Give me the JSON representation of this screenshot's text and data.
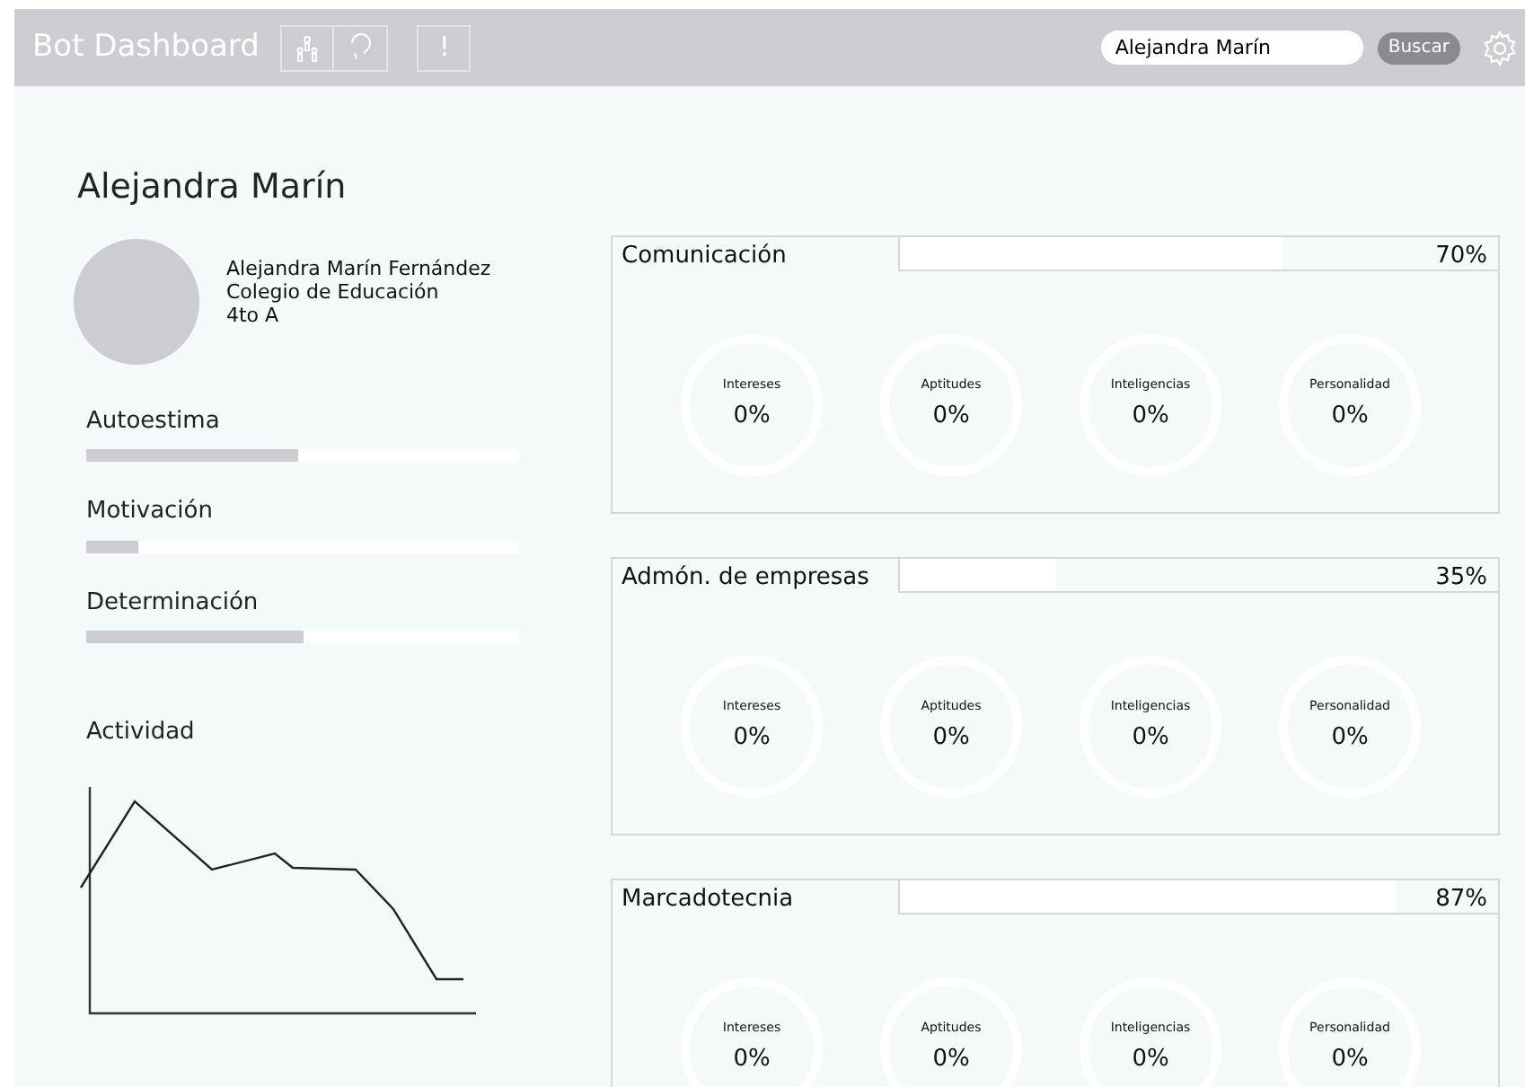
{
  "header": {
    "title": "Bot Dashboard",
    "alert_button": "!",
    "search": {
      "value": "Alejandra Marín"
    },
    "search_button": "Buscar"
  },
  "profile": {
    "heading": "Alejandra Marín",
    "full_name": "Alejandra Marín Fernández",
    "school": "Colegio de Educación",
    "group": "4to A"
  },
  "traits": [
    {
      "label": "Autoestima",
      "level": 0.49
    },
    {
      "label": "Motivación",
      "level": 0.12
    },
    {
      "label": "Determinación",
      "level": 0.5
    }
  ],
  "activity": {
    "title": "Actividad"
  },
  "careers": [
    {
      "name": "Comunicación",
      "level": 0.64,
      "percent": "70%",
      "metrics": [
        {
          "label": "Intereses",
          "value": "0%"
        },
        {
          "label": "Aptitudes",
          "value": "0%"
        },
        {
          "label": "Inteligencias",
          "value": "0%"
        },
        {
          "label": "Personalidad",
          "value": "0%"
        }
      ]
    },
    {
      "name": "Admón. de empresas",
      "level": 0.26,
      "percent": "35%",
      "metrics": [
        {
          "label": "Intereses",
          "value": "0%"
        },
        {
          "label": "Aptitudes",
          "value": "0%"
        },
        {
          "label": "Inteligencias",
          "value": "0%"
        },
        {
          "label": "Personalidad",
          "value": "0%"
        }
      ]
    },
    {
      "name": "Marcadotecnia",
      "level": 0.83,
      "percent": "87%",
      "metrics": [
        {
          "label": "Intereses",
          "value": "0%"
        },
        {
          "label": "Aptitudes",
          "value": "0%"
        },
        {
          "label": "Inteligencias",
          "value": "0%"
        },
        {
          "label": "Personalidad",
          "value": "0%"
        }
      ]
    }
  ]
}
